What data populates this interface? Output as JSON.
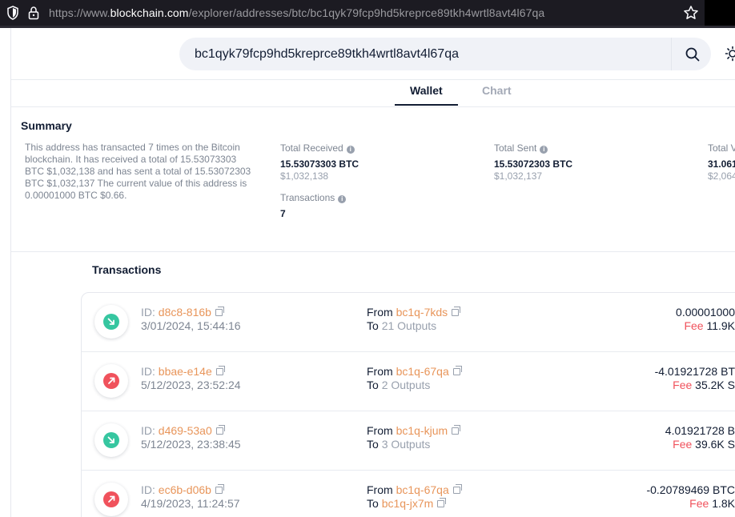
{
  "browser": {
    "url_prefix": "https://www.",
    "url_host": "blockchain.com",
    "url_path": "/explorer/addresses/btc/bc1qyk79fcp9hd5kreprce89tkh4wrtl8avt4l67qa"
  },
  "search": {
    "value": "bc1qyk79fcp9hd5kreprce89tkh4wrtl8avt4l67qa"
  },
  "tabs": [
    {
      "label": "Wallet",
      "active": true
    },
    {
      "label": "Chart",
      "active": false
    }
  ],
  "summary": {
    "title": "Summary",
    "description": "This address has transacted 7 times on the Bitcoin blockchain. It has received a total of 15.53073303 BTC $1,032,138 and has sent a total of 15.53072303 BTC $1,032,137 The current value of this address is 0.00001000 BTC $0.66.",
    "total_received": {
      "label": "Total Received",
      "btc": "15.53073303 BTC",
      "usd": "$1,032,138"
    },
    "total_sent": {
      "label": "Total Sent",
      "btc": "15.53072303 BTC",
      "usd": "$1,032,137"
    },
    "total_volume": {
      "label": "Total V",
      "btc": "31.061",
      "usd": "$2,064"
    },
    "transactions": {
      "label": "Transactions",
      "value": "7"
    }
  },
  "transactions": {
    "title": "Transactions",
    "id_label": "ID:",
    "from_label": "From",
    "to_label": "To",
    "fee_label": "Fee",
    "rows": [
      {
        "direction": "in",
        "id": "d8c8-816b",
        "date": "3/01/2024, 15:44:16",
        "from": "bc1q-7kds",
        "to": "21 Outputs",
        "to_is_addr": false,
        "amount": "0.00001000",
        "fee": "11.9K"
      },
      {
        "direction": "out",
        "id": "bbae-e14e",
        "date": "5/12/2023, 23:52:24",
        "from": "bc1q-67qa",
        "to": "2 Outputs",
        "to_is_addr": false,
        "amount": "-4.01921728 BT",
        "fee": "35.2K S"
      },
      {
        "direction": "in",
        "id": "d469-53a0",
        "date": "5/12/2023, 23:38:45",
        "from": "bc1q-kjum",
        "to": "3 Outputs",
        "to_is_addr": false,
        "amount": "4.01921728 B",
        "fee": "39.6K S"
      },
      {
        "direction": "out",
        "id": "ec6b-d06b",
        "date": "4/19/2023, 11:24:57",
        "from": "bc1q-67qa",
        "to": "bc1q-jx7m",
        "to_is_addr": true,
        "amount": "-0.20789469 BTC",
        "fee": "1.8K"
      }
    ]
  },
  "colors": {
    "accent_orange": "#e8955a",
    "in_green": "#36c6a0",
    "out_red": "#f0525c"
  }
}
